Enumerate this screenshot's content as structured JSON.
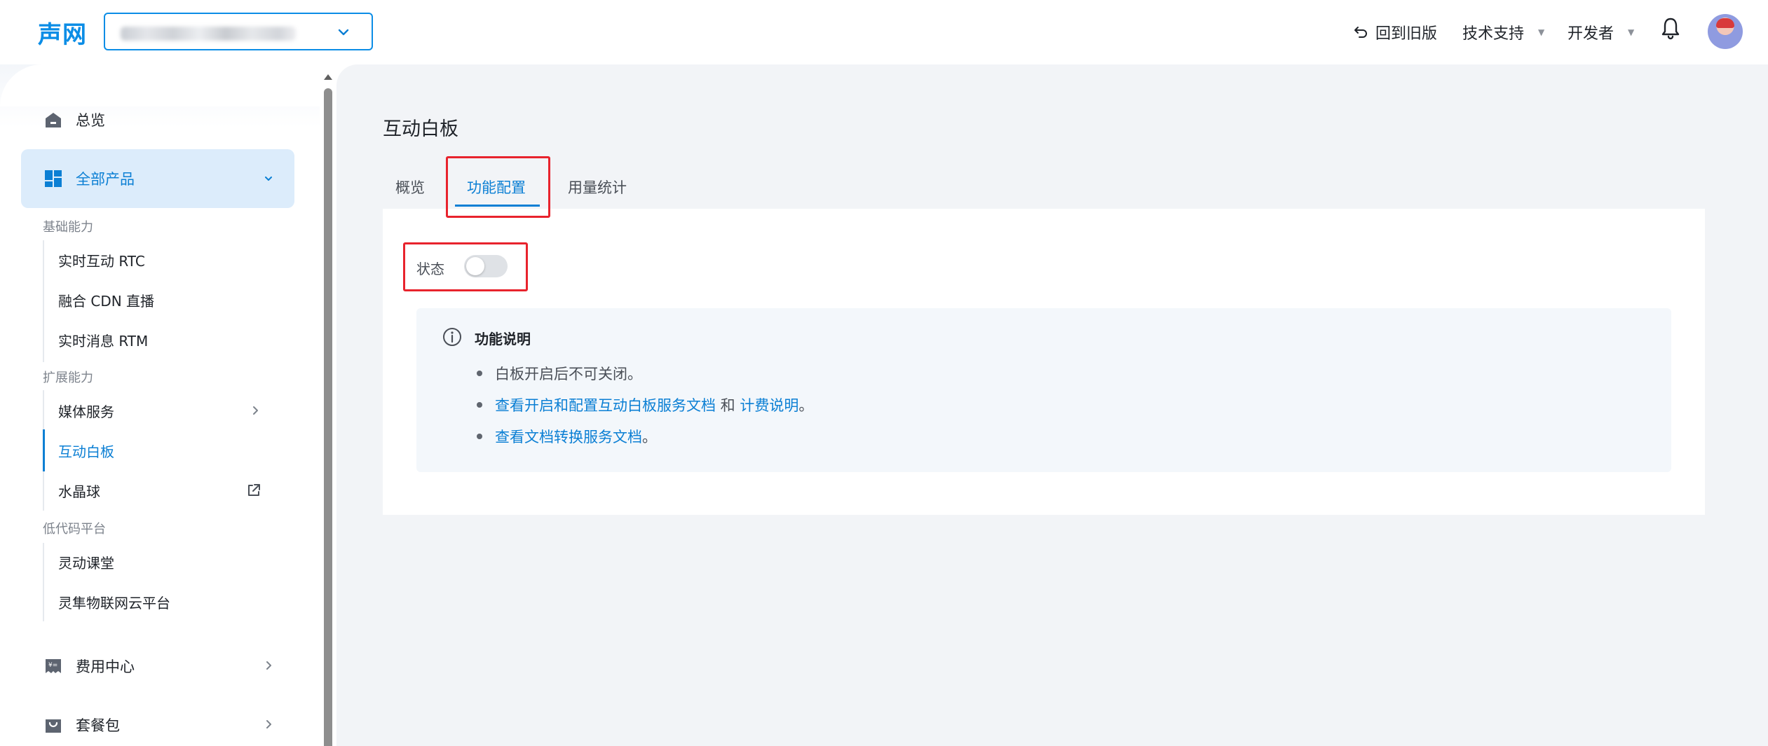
{
  "header": {
    "logo": "声网",
    "back_to_old": "回到旧版",
    "tech_support": "技术支持",
    "developer": "开发者"
  },
  "sidebar": {
    "overview": "总览",
    "all_products": "全部产品",
    "groups": [
      {
        "title": "基础能力",
        "items": [
          "实时互动 RTC",
          "融合 CDN 直播",
          "实时消息 RTM"
        ]
      },
      {
        "title": "扩展能力",
        "items": [
          "媒体服务",
          "互动白板",
          "水晶球"
        ]
      },
      {
        "title": "低代码平台",
        "items": [
          "灵动课堂",
          "灵隼物联网云平台"
        ]
      }
    ],
    "billing": "费用中心",
    "packages": "套餐包"
  },
  "main": {
    "title": "互动白板",
    "tabs": [
      "概览",
      "功能配置",
      "用量统计"
    ],
    "active_tab": "功能配置",
    "status_label": "状态",
    "status_enabled": false,
    "info": {
      "title": "功能说明",
      "line1": "白板开启后不可关闭。",
      "line2_link1": "查看开启和配置互动白板服务文档",
      "line2_and": " 和 ",
      "line2_link2": "计费说明",
      "line2_end": "。",
      "line3_link": "查看文档转换服务文档",
      "line3_end": "。"
    }
  },
  "colors": {
    "accent": "#0b7fd4",
    "highlight_box": "#e8232d"
  }
}
